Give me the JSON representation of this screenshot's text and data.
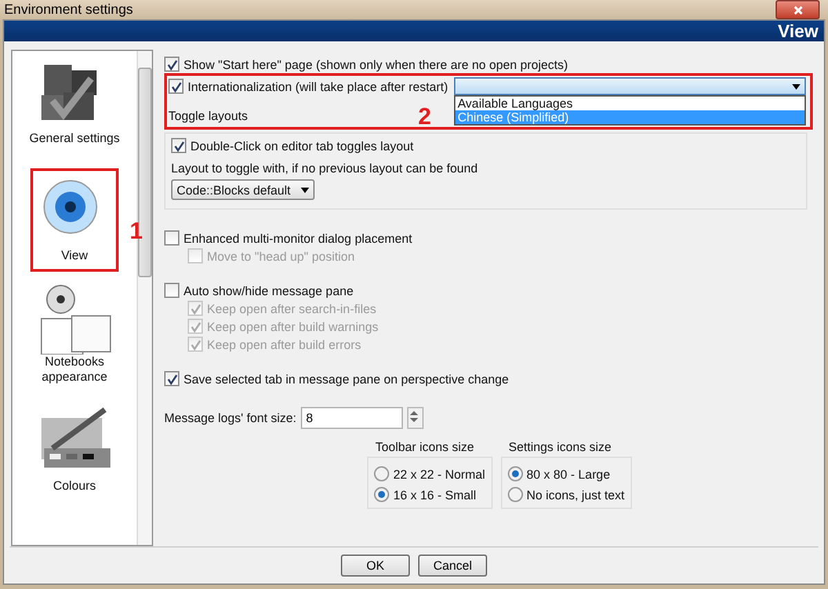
{
  "window": {
    "title": "Environment settings"
  },
  "header": {
    "title": "View"
  },
  "sidebar": {
    "items": [
      {
        "label": "General settings",
        "selected": false
      },
      {
        "label": "View",
        "selected": true
      },
      {
        "label": "Notebooks appearance",
        "selected": false
      },
      {
        "label": "Colours",
        "selected": false
      }
    ]
  },
  "annotations": [
    {
      "label": "1"
    },
    {
      "label": "2"
    }
  ],
  "general": [
    {
      "label": "Show \"Start here\" page (shown only when there are no open projects)",
      "checked": true
    },
    {
      "label": "Internationalization (will take place after restart)",
      "checked": true
    }
  ],
  "language_dropdown": {
    "options": [
      {
        "label": "Available Languages",
        "selected": false
      },
      {
        "label": "Chinese (Simplified)",
        "selected": true
      }
    ]
  },
  "toggle_layouts": {
    "title": "Toggle layouts",
    "double_click": {
      "label": "Double-Click on editor tab toggles layout",
      "checked": true
    },
    "layout_label": "Layout to toggle with, if no previous layout can be found",
    "layout_value": "Code::Blocks default"
  },
  "options": [
    {
      "label": "Enhanced multi-monitor dialog placement",
      "checked": false,
      "children": [
        {
          "label": "Move to \"head up\" position",
          "checked": false,
          "disabled": true
        }
      ]
    },
    {
      "label": "Auto show/hide message pane",
      "checked": false,
      "children": [
        {
          "label": "Keep open after search-in-files",
          "checked": true,
          "disabled": true
        },
        {
          "label": "Keep open after build warnings",
          "checked": true,
          "disabled": true
        },
        {
          "label": "Keep open after build errors",
          "checked": true,
          "disabled": true
        }
      ]
    },
    {
      "label": "Save selected tab in message pane on perspective change",
      "checked": true
    }
  ],
  "font_size": {
    "label": "Message logs' font size:",
    "value": "8"
  },
  "radio_groups": [
    {
      "title": "Toolbar icons size",
      "options": [
        {
          "label": "22 x 22 - Normal",
          "selected": false
        },
        {
          "label": "16 x 16 - Small",
          "selected": true
        }
      ]
    },
    {
      "title": "Settings icons size",
      "options": [
        {
          "label": "80 x 80 - Large",
          "selected": true
        },
        {
          "label": "No icons, just text",
          "selected": false
        }
      ]
    }
  ],
  "buttons": [
    "OK",
    "Cancel"
  ]
}
